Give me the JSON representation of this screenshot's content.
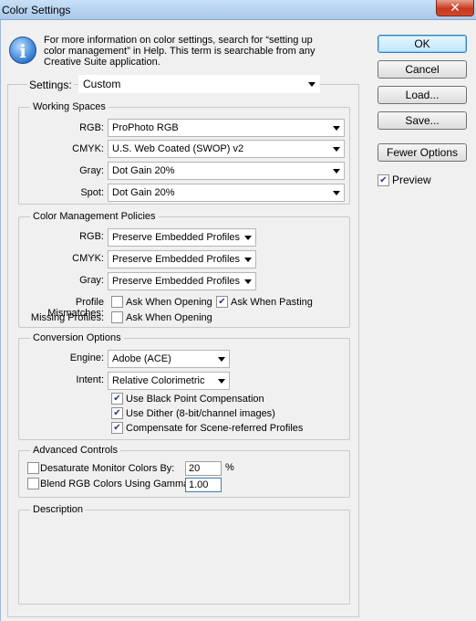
{
  "window": {
    "title": "Color Settings",
    "close_glyph": "✕"
  },
  "info": {
    "icon": "info-icon",
    "icon_glyph": "i",
    "text": "For more information on color settings, search for “setting up color management” in Help. This term is searchable from any Creative Suite application."
  },
  "buttons": {
    "ok": "OK",
    "cancel": "Cancel",
    "load": "Load...",
    "save": "Save...",
    "fewer_options": "Fewer Options"
  },
  "preview": {
    "label": "Preview",
    "checked": true
  },
  "settings": {
    "label": "Settings:",
    "value": "Custom"
  },
  "working_spaces": {
    "title": "Working Spaces",
    "rgb": {
      "label": "RGB:",
      "value": "ProPhoto RGB"
    },
    "cmyk": {
      "label": "CMYK:",
      "value": "U.S. Web Coated (SWOP) v2"
    },
    "gray": {
      "label": "Gray:",
      "value": "Dot Gain 20%"
    },
    "spot": {
      "label": "Spot:",
      "value": "Dot Gain 20%"
    }
  },
  "policies": {
    "title": "Color Management Policies",
    "rgb": {
      "label": "RGB:",
      "value": "Preserve Embedded Profiles"
    },
    "cmyk": {
      "label": "CMYK:",
      "value": "Preserve Embedded Profiles"
    },
    "gray": {
      "label": "Gray:",
      "value": "Preserve Embedded Profiles"
    },
    "profile_mismatches": {
      "label": "Profile Mismatches:",
      "ask_opening": {
        "label": "Ask When Opening",
        "checked": false
      },
      "ask_pasting": {
        "label": "Ask When Pasting",
        "checked": true
      }
    },
    "missing_profiles": {
      "label": "Missing Profiles:",
      "ask_opening": {
        "label": "Ask When Opening",
        "checked": false
      }
    }
  },
  "conversion": {
    "title": "Conversion Options",
    "engine": {
      "label": "Engine:",
      "value": "Adobe (ACE)"
    },
    "intent": {
      "label": "Intent:",
      "value": "Relative Colorimetric"
    },
    "black_point": {
      "label": "Use Black Point Compensation",
      "checked": true
    },
    "dither": {
      "label": "Use Dither (8-bit/channel images)",
      "checked": true
    },
    "scene_referred": {
      "label": "Compensate for Scene-referred Profiles",
      "checked": true
    }
  },
  "advanced": {
    "title": "Advanced Controls",
    "desaturate": {
      "label": "Desaturate Monitor Colors By:",
      "value": "20",
      "unit": "%",
      "checked": false
    },
    "blend": {
      "label": "Blend RGB Colors Using Gamma:",
      "value": "1.00",
      "checked": false
    }
  },
  "description": {
    "title": "Description"
  }
}
